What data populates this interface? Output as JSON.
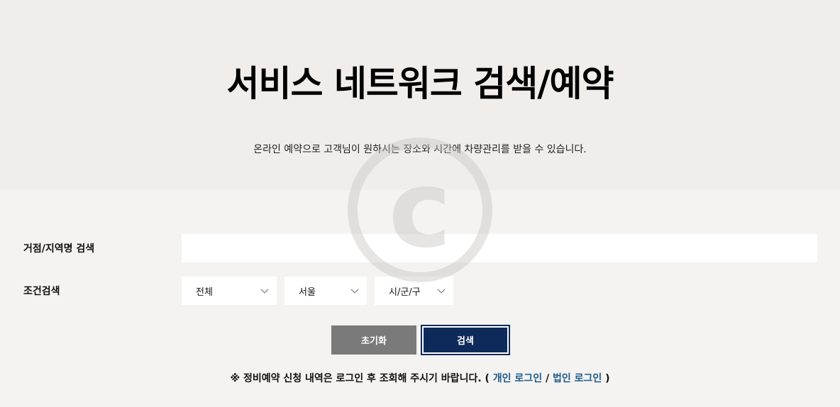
{
  "header": {
    "title": "서비스 네트워크 검색/예약",
    "subtitle": "온라인 예약으로 고객님이 원하시는 장소와 시간에 차량관리를 받을 수 있습니다."
  },
  "form": {
    "location_label": "거점/지역명 검색",
    "location_value": "",
    "condition_label": "조건검색",
    "filter_type": "전체",
    "filter_region": "서울",
    "filter_district": "시/군/구"
  },
  "actions": {
    "reset_label": "초기화",
    "search_label": "검색"
  },
  "notice": {
    "prefix": "※ 정비예약 신청 내역은 로그인 후 조회해 주시기 바랍니다. (",
    "personal_login": "개인 로그인",
    "separator": "/",
    "corporate_login": "법인 로그인",
    "suffix": ")"
  },
  "colors": {
    "search_button": "#0e2a5a",
    "reset_button": "#7a7a7a",
    "link": "#1c5a8c"
  }
}
